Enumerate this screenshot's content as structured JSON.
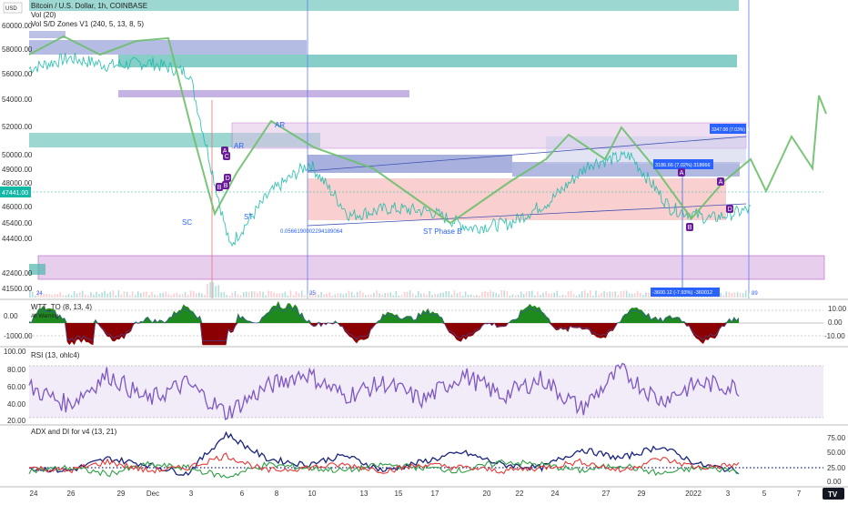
{
  "header": {
    "currency_badge": "USD",
    "title": "Bitcoin / U.S. Dollar, 1h, COINBASE",
    "indicators": [
      "Vol (20)",
      "Vol S/D Zones V1 (240, 5, 13, 8, 5)"
    ],
    "logo_text": "TV"
  },
  "colors": {
    "price": "#14b8a6",
    "zigzag": "#6cbf6c",
    "wt_pos": "#1e8a1e",
    "wt_neg": "#8b0000",
    "rsi": "#7e57c2",
    "adx": "#1a237e",
    "di_plus": "#2e9e44",
    "di_minus": "#e53935",
    "teal_zone": "#4db6ac",
    "purple_zone": "#b388d4",
    "blue_zone": "#5c6bc0",
    "range_fill": "#f8bbbb"
  },
  "main": {
    "y_ticks": [
      "60000.00",
      "58000.00",
      "56000.00",
      "54000.00",
      "52000.00",
      "50000.00",
      "49000.00",
      "48000.00",
      "46000.00",
      "45400.00",
      "44400.00",
      "42400.00",
      "41500.00"
    ],
    "price_tag": "47441.00",
    "labels": {
      "sc": "SC",
      "st": "ST",
      "ar": "AR",
      "ar_top": "AR",
      "st_phase_b": "ST Phase B",
      "fib_text": "0.0566190002294189064",
      "vol_left": "24",
      "vol_mid": "35",
      "vol_right": "89"
    },
    "measures": [
      {
        "text": "3347.08 (7.03%) 334708"
      },
      {
        "text": "3186.66 (7.02%) 318666"
      },
      {
        "text": "-3600.12 (-7.93%) -360012"
      }
    ],
    "badges": [
      "A",
      "C",
      "D",
      "B",
      "A",
      "B",
      "A",
      "D",
      "B"
    ]
  },
  "panels": {
    "wt": {
      "name": "WTT_TO (8, 13, 4)",
      "sub": "All Warning",
      "left_ticks": [
        "0.00",
        "-1000.00"
      ],
      "right_ticks": [
        "10.00",
        "0.00",
        "-10.00"
      ]
    },
    "rsi": {
      "name": "RSI (13, ohlc4)",
      "ticks": [
        "100.00",
        "80.00",
        "60.00",
        "40.00",
        "20.00"
      ]
    },
    "adx": {
      "name": "ADX and DI for v4 (13, 21)",
      "ticks": [
        "75.00",
        "50.00",
        "25.00",
        "0.00"
      ]
    }
  },
  "x_axis": [
    "24",
    "26",
    "29",
    "Dec",
    "3",
    "6",
    "8",
    "10",
    "13",
    "15",
    "17",
    "20",
    "22",
    "24",
    "27",
    "29",
    "2022",
    "3",
    "5",
    "7"
  ],
  "chart_data": [
    {
      "type": "line",
      "title": "Bitcoin / U.S. Dollar, 1h, COINBASE",
      "series": [
        {
          "name": "BTCUSD",
          "x": [
            "24",
            "26",
            "29",
            "Dec",
            "3",
            "4",
            "6",
            "8",
            "10",
            "13",
            "15",
            "17",
            "20",
            "22",
            "24",
            "27",
            "29",
            "2022",
            "3"
          ],
          "values": [
            56800,
            57500,
            57000,
            57200,
            56500,
            45000,
            48500,
            50500,
            47000,
            47500,
            47300,
            46200,
            46500,
            48000,
            50500,
            51000,
            47500,
            46800,
            47441
          ]
        }
      ],
      "ylim": [
        41500,
        61000
      ]
    },
    {
      "type": "line",
      "title": "RSI (13, ohlc4)",
      "series": [
        {
          "name": "RSI",
          "values": [
            55,
            35,
            70,
            40,
            60,
            25,
            55,
            72,
            45,
            60,
            40,
            70,
            45,
            65,
            30,
            75,
            40,
            60,
            55
          ]
        }
      ],
      "ylim": [
        20,
        80
      ]
    },
    {
      "type": "line",
      "title": "ADX and DI for v4 (13, 21)",
      "series": [
        {
          "name": "ADX",
          "values": [
            25,
            20,
            40,
            30,
            15,
            80,
            40,
            30,
            45,
            20,
            35,
            50,
            30,
            25,
            55,
            40,
            60,
            30,
            20
          ]
        },
        {
          "name": "+DI",
          "values": [
            20,
            25,
            15,
            30,
            25,
            10,
            30,
            25,
            20,
            30,
            25,
            20,
            35,
            30,
            20,
            30,
            15,
            25,
            20
          ]
        },
        {
          "name": "-DI",
          "values": [
            25,
            20,
            35,
            20,
            25,
            45,
            20,
            25,
            30,
            20,
            30,
            25,
            20,
            25,
            35,
            20,
            40,
            25,
            30
          ]
        }
      ],
      "ylim": [
        0,
        90
      ]
    }
  ]
}
